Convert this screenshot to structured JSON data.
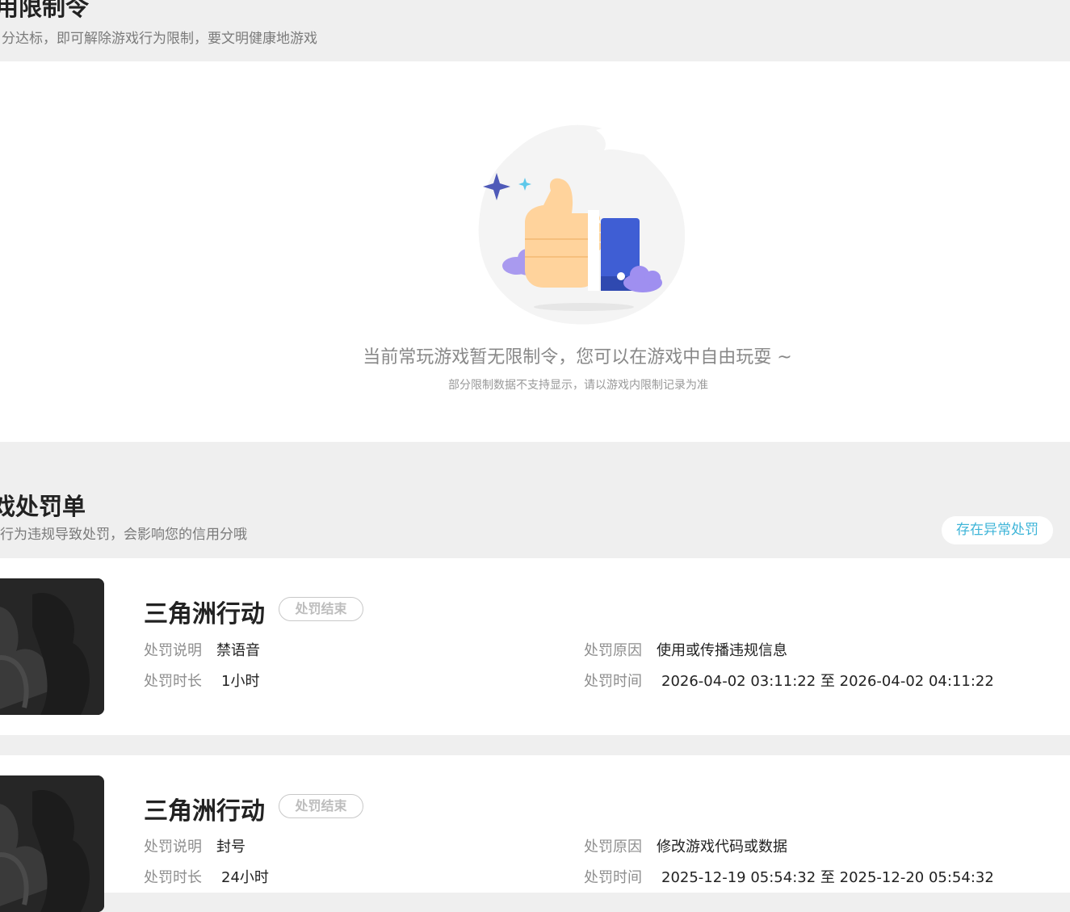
{
  "restriction_section": {
    "title": "用限制令",
    "subtitle": "分达标，即可解除游戏行为限制，要文明健康地游戏",
    "empty_state": {
      "message": "当前常玩游戏暂无限制令，您可以在游戏中自由玩耍 ~",
      "note": "部分限制数据不支持显示，请以游戏内限制记录为准",
      "illustration": "thumbs-up-icon"
    }
  },
  "penalty_section": {
    "title": "戏处罚单",
    "subtitle": "行为违规导致处罚，会影响您的信用分哦",
    "abnormal_button": "存在异常处罚",
    "labels": {
      "desc": "处罚说明",
      "reason": "处罚原因",
      "duration": "处罚时长",
      "time": "处罚时间"
    },
    "records": [
      {
        "game": "三角洲行动",
        "status": "处罚结束",
        "desc": "禁语音",
        "reason": "使用或传播违规信息",
        "duration": "1小时",
        "time": "2026-04-02 03:11:22 至 2026-04-02 04:11:22"
      },
      {
        "game": "三角洲行动",
        "status": "处罚结束",
        "desc": "封号",
        "reason": "修改游戏代码或数据",
        "duration": "24小时",
        "time": "2025-12-19 05:54:32 至 2025-12-20 05:54:32"
      }
    ]
  },
  "colors": {
    "page_bg": "#efefef",
    "card_bg": "#ffffff",
    "accent": "#3fb5d8",
    "muted": "#8e8e8e"
  }
}
